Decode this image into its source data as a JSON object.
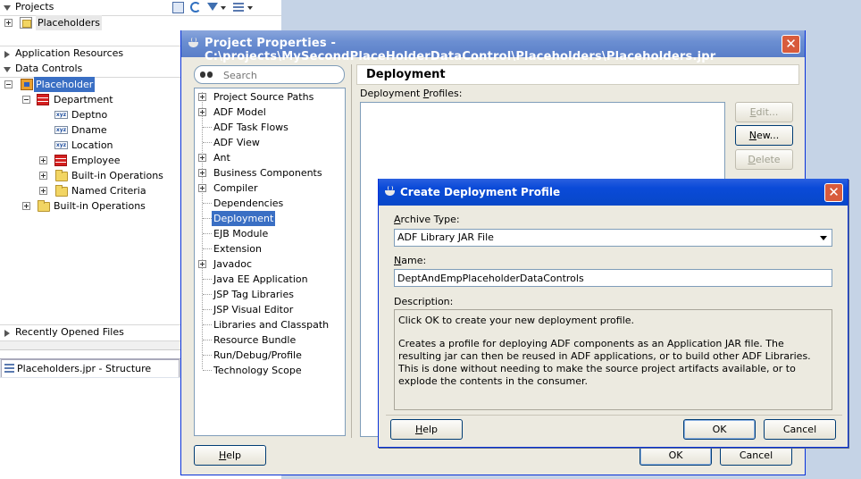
{
  "ide": {
    "projects_label": "Projects",
    "project_root": "Placeholders",
    "app_resources_label": "Application Resources",
    "data_controls_label": "Data Controls",
    "tree": {
      "root": "Placeholder",
      "collection": "Department",
      "attributes": [
        "Deptno",
        "Dname",
        "Location"
      ],
      "child_collection": "Employee",
      "inner_ops": "Built-in Operations",
      "named_criteria": "Named Criteria",
      "outer_ops": "Built-in Operations"
    },
    "recent_files_label": "Recently Opened Files",
    "structure_tab": "Placeholders.jpr - Structure"
  },
  "project_properties": {
    "title": "Project Properties - C:\\projects\\MySecondPlaceHolderDataControl\\Placeholders\\Placeholders.jpr",
    "search_placeholder": "Search",
    "nav_items": [
      {
        "label": "Project Source Paths",
        "expandable": true
      },
      {
        "label": "ADF Model",
        "expandable": true
      },
      {
        "label": "ADF Task Flows",
        "expandable": false
      },
      {
        "label": "ADF View",
        "expandable": false
      },
      {
        "label": "Ant",
        "expandable": true
      },
      {
        "label": "Business Components",
        "expandable": true
      },
      {
        "label": "Compiler",
        "expandable": true
      },
      {
        "label": "Dependencies",
        "expandable": false
      },
      {
        "label": "Deployment",
        "expandable": false,
        "selected": true
      },
      {
        "label": "EJB Module",
        "expandable": false
      },
      {
        "label": "Extension",
        "expandable": false
      },
      {
        "label": "Javadoc",
        "expandable": true
      },
      {
        "label": "Java EE Application",
        "expandable": false
      },
      {
        "label": "JSP Tag Libraries",
        "expandable": false
      },
      {
        "label": "JSP Visual Editor",
        "expandable": false
      },
      {
        "label": "Libraries and Classpath",
        "expandable": false
      },
      {
        "label": "Resource Bundle",
        "expandable": false
      },
      {
        "label": "Run/Debug/Profile",
        "expandable": false
      },
      {
        "label": "Technology Scope",
        "expandable": false
      }
    ],
    "section_title": "Deployment",
    "profiles_label_pre": "Deployment ",
    "profiles_label_key": "P",
    "profiles_label_post": "rofiles:",
    "edit_pre": "",
    "edit_key": "E",
    "edit_post": "dit...",
    "new_pre": "",
    "new_key": "N",
    "new_post": "ew...",
    "delete_pre": "",
    "delete_key": "D",
    "delete_post": "elete",
    "help_pre": "",
    "help_key": "H",
    "help_post": "elp",
    "ok_label": "OK",
    "cancel_label": "Cancel"
  },
  "create_profile": {
    "title": "Create Deployment Profile",
    "archive_type_key": "A",
    "archive_type_post": "rchive Type:",
    "archive_type_value": "ADF Library JAR File",
    "name_key": "N",
    "name_post": "ame:",
    "name_value": "DeptAndEmpPlaceholderDataControls",
    "description_label": "Description:",
    "description_p1": "Click OK to create your new deployment profile.",
    "description_p2": "Creates a profile for deploying ADF components as an Application JAR file. The resulting jar can then be reused in ADF applications, or to build other ADF Libraries. This is done without needing to make the source project artifacts available, or to explode the contents in the consumer.",
    "help_key": "H",
    "help_post": "elp",
    "ok_label": "OK",
    "cancel_label": "Cancel"
  }
}
